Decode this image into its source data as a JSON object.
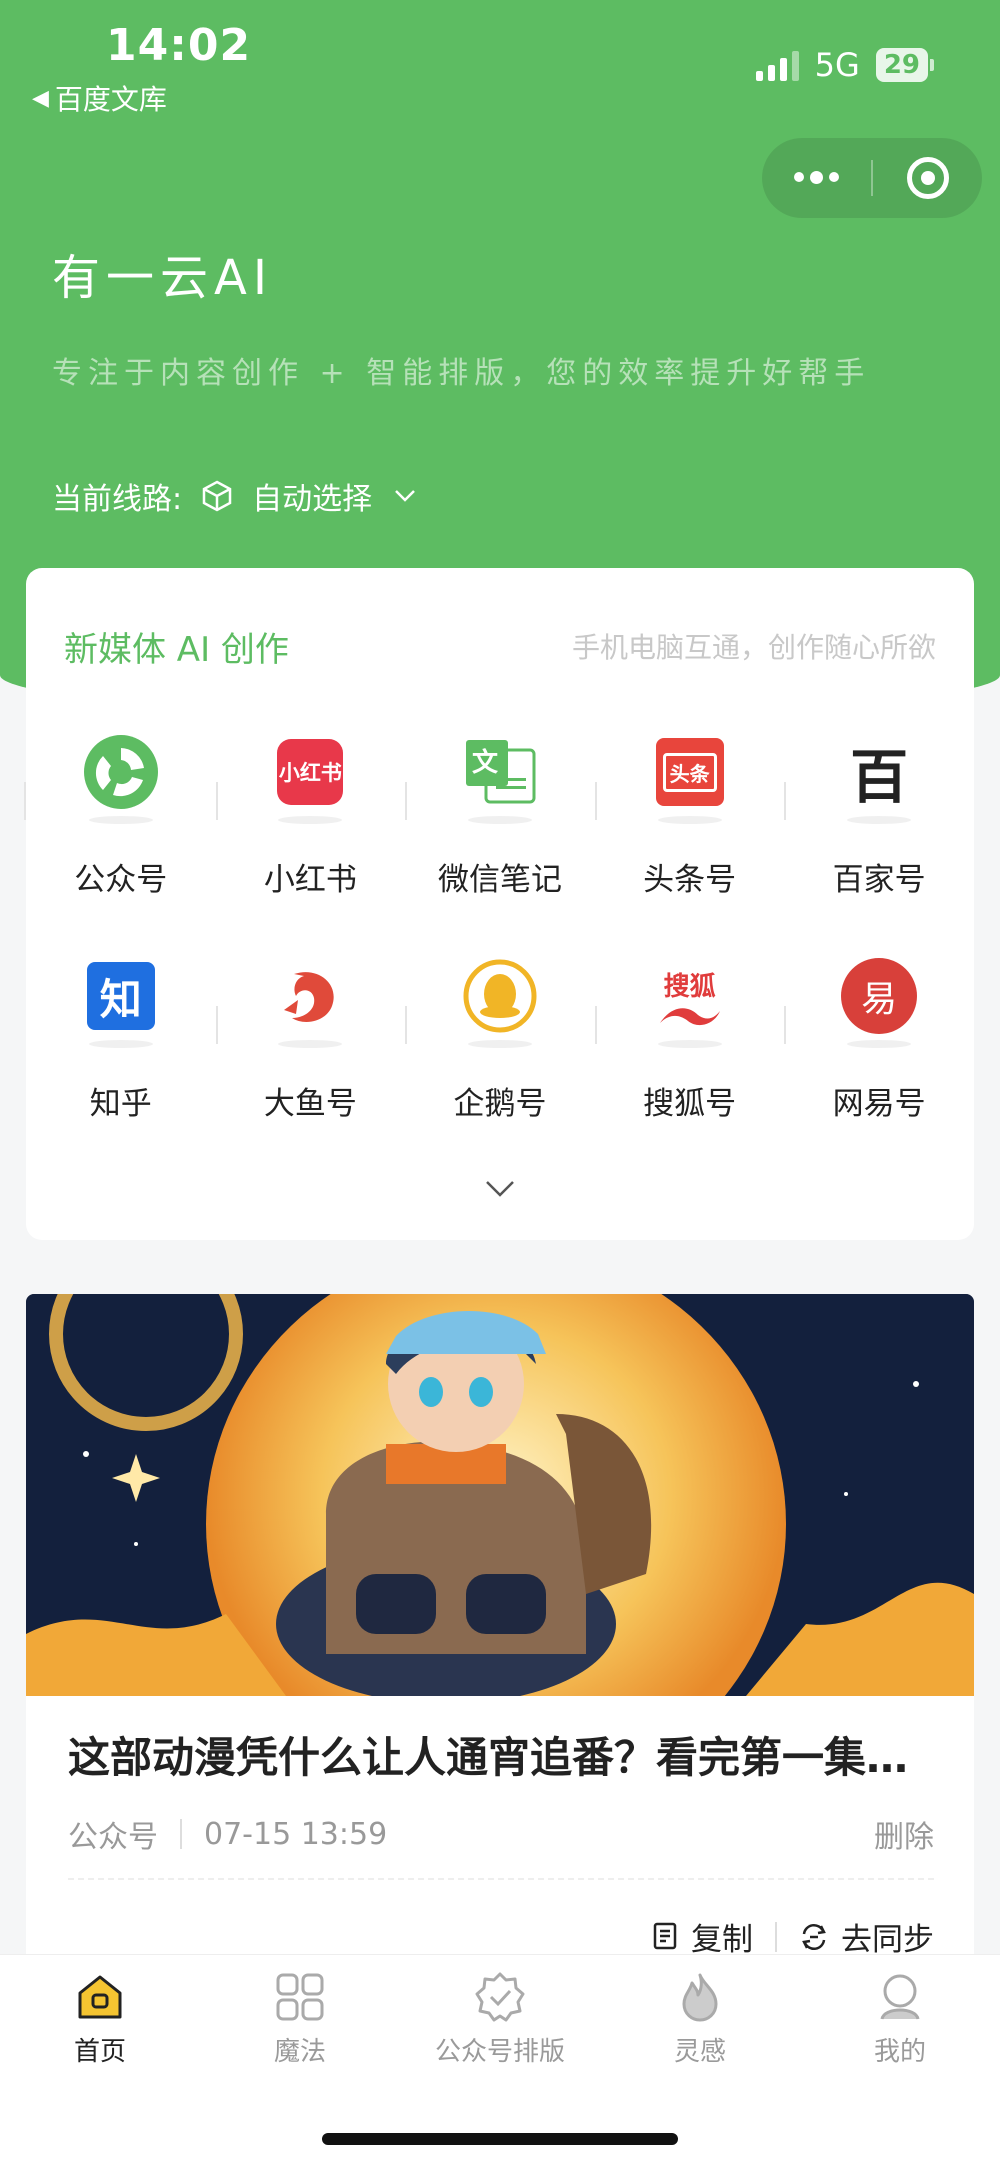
{
  "status": {
    "time": "14:02",
    "back_app": "百度文库",
    "network": "5G",
    "battery": "29"
  },
  "header": {
    "title": "有一云AI",
    "subtitle": "专注于内容创作 + 智能排版，您的效率提升好帮手",
    "route_label": "当前线路:",
    "route_value": "自动选择"
  },
  "media_card": {
    "title": "新媒体 AI 创作",
    "tagline": "手机电脑互通，创作随心所欲",
    "items": [
      {
        "label": "公众号",
        "icon": "wechat-official-icon"
      },
      {
        "label": "小红书",
        "icon": "xiaohongshu-icon",
        "icon_text": "小红书"
      },
      {
        "label": "微信笔记",
        "icon": "wechat-note-icon",
        "icon_text": "文"
      },
      {
        "label": "头条号",
        "icon": "toutiao-icon",
        "icon_text": "头条"
      },
      {
        "label": "百家号",
        "icon": "baijiahao-icon",
        "icon_text": "百"
      },
      {
        "label": "知乎",
        "icon": "zhihu-icon",
        "icon_text": "知"
      },
      {
        "label": "大鱼号",
        "icon": "dayu-icon"
      },
      {
        "label": "企鹅号",
        "icon": "penguin-icon"
      },
      {
        "label": "搜狐号",
        "icon": "sohu-icon",
        "icon_text": "搜狐"
      },
      {
        "label": "网易号",
        "icon": "netease-icon",
        "icon_text": "易"
      }
    ]
  },
  "article": {
    "title": "这部动漫凭什么让人通宵追番？看完第一集就...",
    "source": "公众号",
    "time": "07-15 13:59",
    "delete_label": "删除",
    "copy_label": "复制",
    "sync_label": "去同步"
  },
  "tabbar": {
    "tabs": [
      {
        "label": "首页",
        "icon": "home-icon"
      },
      {
        "label": "魔法",
        "icon": "grid-icon"
      },
      {
        "label": "公众号排版",
        "icon": "badge-check-icon"
      },
      {
        "label": "灵感",
        "icon": "flame-icon"
      },
      {
        "label": "我的",
        "icon": "user-icon"
      }
    ],
    "active_index": 0
  },
  "colors": {
    "brand_green": "#5dbc62"
  }
}
